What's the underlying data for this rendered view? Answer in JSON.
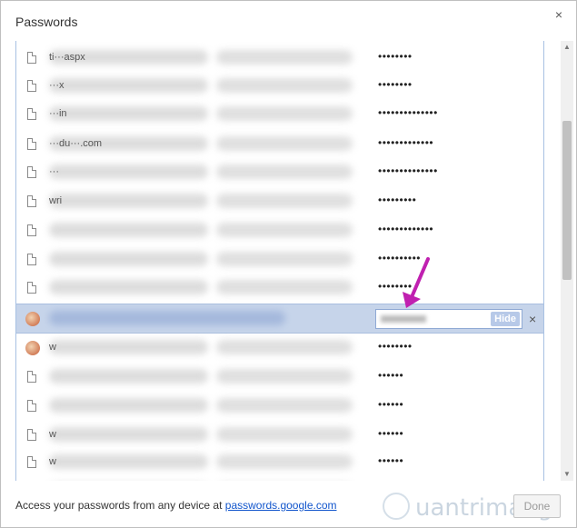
{
  "dialog": {
    "title": "Passwords",
    "close_glyph": "×"
  },
  "rows": [
    {
      "site": "ti···aspx",
      "password": "••••••••",
      "icon": "file-icon"
    },
    {
      "site": "···x",
      "password": "••••••••",
      "icon": "file-icon"
    },
    {
      "site": "···in",
      "password": "••••••••••••••",
      "icon": "file-icon"
    },
    {
      "site": "···du···.com",
      "password": "•••••••••••••",
      "icon": "file-icon"
    },
    {
      "site": "···",
      "password": "••••••••••••••",
      "icon": "file-icon"
    },
    {
      "site": "wri",
      "password": "•••••••••",
      "icon": "file-icon"
    },
    {
      "site": "",
      "password": "•••••••••••••",
      "icon": "file-icon"
    },
    {
      "site": "",
      "password": "••••••••••",
      "icon": "file-icon"
    },
    {
      "site": "",
      "password": "••••••••",
      "icon": "file-icon"
    },
    {
      "site": "",
      "password": "",
      "icon": "avatar",
      "selected": true,
      "hide_label": "Hide",
      "remove_glyph": "×"
    },
    {
      "site": "w",
      "password": "••••••••",
      "icon": "avatar"
    },
    {
      "site": "",
      "password": "••••••",
      "icon": "file-icon"
    },
    {
      "site": "",
      "password": "••••••",
      "icon": "file-icon"
    },
    {
      "site": "w",
      "password": "••••••",
      "icon": "file-icon"
    },
    {
      "site": "w",
      "password": "••••••",
      "icon": "file-icon"
    },
    {
      "site": "",
      "password": "••••••",
      "icon": "file-icon"
    }
  ],
  "footer": {
    "text": "Access your passwords from any device at ",
    "link": "passwords.google.com",
    "done_label": "Done"
  },
  "watermark": "uantrimang",
  "colors": {
    "selected_row": "#c6d4ea",
    "link": "#1155cc",
    "arrow": "#c020b0"
  }
}
